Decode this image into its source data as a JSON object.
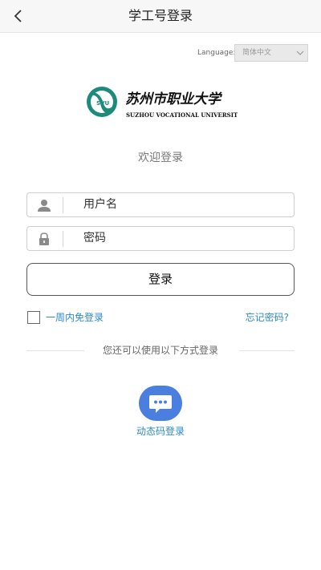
{
  "header": {
    "title": "学工号登录",
    "back_icon": "chevron-left-icon"
  },
  "language": {
    "label": "Language:",
    "selected": "简体中文"
  },
  "logo": {
    "name_cn": "苏州市职业大学",
    "name_en": "SUZHOU VOCATIONAL UNIVERSITY",
    "badge": "SVU",
    "color": "#1c8b7c"
  },
  "welcome": "欢迎登录",
  "username": {
    "placeholder": "用户名",
    "icon": "user-icon"
  },
  "password": {
    "placeholder": "密码",
    "icon": "lock-icon"
  },
  "login_button": "登录",
  "remember": "一周内免登录",
  "forgot": "忘记密码?",
  "other_methods": "您还可以使用以下方式登录",
  "sms_login": {
    "label": "动态码登录",
    "icon": "chat-bubble-icon",
    "color": "#4a7fe0"
  },
  "colors": {
    "link": "#2b8ac8",
    "header_bg": "#f7f7f7"
  }
}
